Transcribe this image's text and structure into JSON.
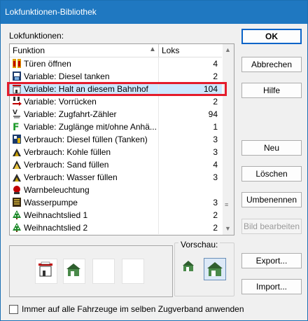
{
  "window": {
    "title": "Lokfunktionen-Bibliothek"
  },
  "list": {
    "label": "Lokfunktionen:",
    "columns": [
      "Funktion",
      "Loks"
    ],
    "rows": [
      {
        "name": "Türen öffnen",
        "count": "4",
        "icon": "doors-icon"
      },
      {
        "name": "Variable: Diesel tanken",
        "count": "2",
        "icon": "fuel-pump-icon"
      },
      {
        "name": "Variable: Halt an diesem Bahnhof",
        "count": "104",
        "icon": "station-stop-icon",
        "selected": true
      },
      {
        "name": "Variable: Vorrücken",
        "count": "2",
        "icon": "advance-arrow-icon"
      },
      {
        "name": "Variable: Zugfahrt-Zähler",
        "count": "94",
        "icon": "counter-icon"
      },
      {
        "name": "Variable: Zuglänge mit/ohne Anhä...",
        "count": "1",
        "icon": "train-length-icon"
      },
      {
        "name": "Verbrauch: Diesel füllen (Tanken)",
        "count": "3",
        "icon": "diesel-fill-icon"
      },
      {
        "name": "Verbrauch: Kohle füllen",
        "count": "3",
        "icon": "coal-fill-icon"
      },
      {
        "name": "Verbrauch: Sand füllen",
        "count": "4",
        "icon": "sand-fill-icon"
      },
      {
        "name": "Verbrauch: Wasser füllen",
        "count": "3",
        "icon": "water-fill-icon"
      },
      {
        "name": "Warnbeleuchtung",
        "count": "",
        "icon": "warning-light-icon"
      },
      {
        "name": "Wasserpumpe",
        "count": "3",
        "icon": "water-pump-icon"
      },
      {
        "name": "Weihnachtslied 1",
        "count": "2",
        "icon": "christmas-tree-icon"
      },
      {
        "name": "Weihnachtslied 2",
        "count": "2",
        "icon": "christmas-tree-icon"
      }
    ]
  },
  "buttons": {
    "ok": "OK",
    "cancel": "Abbrechen",
    "help": "Hilfe",
    "new": "Neu",
    "delete": "Löschen",
    "rename": "Umbenennen",
    "edit_image": "Bild bearbeiten",
    "export": "Export...",
    "import": "Import..."
  },
  "preview": {
    "label": "Vorschau:"
  },
  "options": {
    "apply_all": "Immer auf alle Fahrzeuge im selben Zugverband anwenden"
  },
  "colors": {
    "selection_highlight": "#e41c2c",
    "title_bar": "#1f78c1",
    "default_button_border": "#0a64c8"
  }
}
